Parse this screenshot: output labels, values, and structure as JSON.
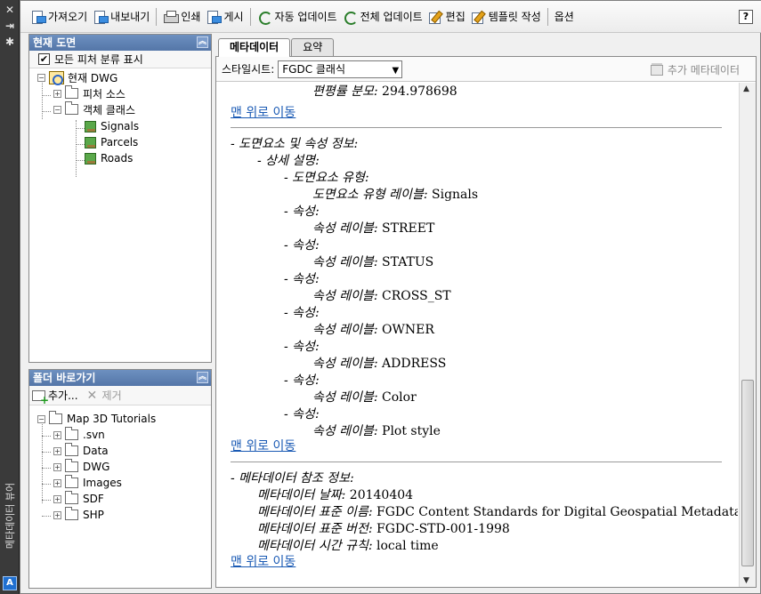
{
  "palette": {
    "title": "메타데이터 뷰어",
    "close_glyph": "✕",
    "pin_glyph": "⇥",
    "options_glyph": "✱",
    "logo_glyph": "A"
  },
  "toolbar": {
    "import_label": "가져오기",
    "export_label": "내보내기",
    "print_label": "인쇄",
    "publish_label": "게시",
    "auto_update_label": "자동 업데이트",
    "update_all_label": "전체 업데이트",
    "edit_label": "편집",
    "create_template_label": "템플릿 작성",
    "options_label": "옵션",
    "help_label": "?"
  },
  "drawing_panel": {
    "title": "현재 도면",
    "show_all_label": "모든 피처 분류 표시",
    "show_all_checked": "✔",
    "tree": {
      "root": "현재 DWG",
      "feature_sources": "피처 소스",
      "object_classes": "객체 클래스",
      "layers": [
        "Signals",
        "Parcels",
        "Roads"
      ]
    }
  },
  "folder_panel": {
    "title": "폴더 바로가기",
    "add_label": "추가...",
    "remove_label": "제거",
    "root": "Map 3D Tutorials",
    "folders": [
      ".svn",
      "Data",
      "DWG",
      "Images",
      "SDF",
      "SHP"
    ]
  },
  "tabs": {
    "metadata": "메타데이터",
    "summary": "요약"
  },
  "style_bar": {
    "label": "스타일시트:",
    "selected": "FGDC 클래식",
    "add_metadata": "추가 메타데이터"
  },
  "document": {
    "partial_top_label": "편평률 분모:",
    "partial_top_value": "294.978698",
    "back_to_top": "맨 위로 이동",
    "entity_section": {
      "heading": "- 도면요소 및 속성 정보:",
      "detailed": "- 상세 설명:",
      "entity_type": "- 도면요소 유형:",
      "entity_type_label": "도면요소 유형 레이블:",
      "entity_type_value": "Signals",
      "attribute_heading": "- 속성:",
      "attribute_label": "속성 레이블:",
      "attributes": [
        "STREET",
        "STATUS",
        "CROSS_ST",
        "OWNER",
        "ADDRESS",
        "Color",
        "Plot style"
      ]
    },
    "metadata_section": {
      "heading": "- 메타데이터 참조 정보:",
      "date_label": "메타데이터 날짜:",
      "date_value": "20140404",
      "standard_name_label": "메타데이터 표준 이름:",
      "standard_name_value": "FGDC Content Standards for Digital Geospatial Metadata",
      "standard_version_label": "메타데이터 표준 버전:",
      "standard_version_value": "FGDC-STD-001-1998",
      "time_convention_label": "메타데이터 시간 규칙:",
      "time_convention_value": "local time"
    }
  },
  "colors": {
    "panel_header": "#5476a8",
    "link": "#1a5ab4",
    "palette_bg": "#3a3a3a"
  }
}
